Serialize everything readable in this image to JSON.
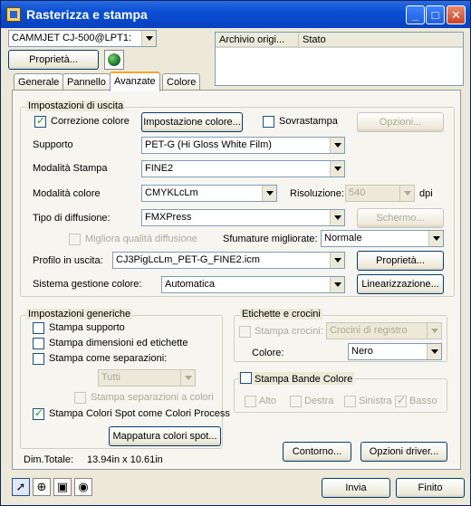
{
  "window": {
    "title": "Rasterizza e stampa"
  },
  "printer": {
    "selected": "CAMMJET CJ-500@LPT1:",
    "properties_label": "Proprietà..."
  },
  "jobs_list": {
    "columns": [
      "Archivio origi...",
      "Stato"
    ]
  },
  "tabs": [
    "Generale",
    "Pannello",
    "Avanzate",
    "Colore"
  ],
  "active_tab": "Avanzate",
  "output_settings": {
    "legend": "Impostazioni di uscita",
    "color_correction": {
      "label": "Correzione colore",
      "checked": true
    },
    "color_setup_button": "Impostazione colore...",
    "overprint": {
      "label": "Sovrastampa",
      "checked": false
    },
    "options_button": "Opzioni...",
    "media": {
      "label": "Supporto",
      "value": "PET-G (Hi Gloss White Film)"
    },
    "print_mode": {
      "label": "Modalità Stampa",
      "value": "FINE2"
    },
    "color_mode": {
      "label": "Modalità colore",
      "value": "CMYKLcLm"
    },
    "resolution": {
      "label": "Risoluzione:",
      "value": "540",
      "unit": "dpi"
    },
    "dither": {
      "label": "Tipo di diffusione:",
      "value": "FMXPress"
    },
    "screen_button": "Schermo...",
    "better_dither": {
      "label": "Migliora qualità diffusione",
      "checked": false
    },
    "gradients": {
      "label": "Sfumature migliorate:",
      "value": "Normale"
    },
    "output_profile": {
      "label": "Profilo in uscita:",
      "value": "CJ3PigLcLm_PET-G_FINE2.icm"
    },
    "profile_properties_button": "Proprietà...",
    "cms": {
      "label": "Sistema gestione colore:",
      "value": "Automatica"
    },
    "linearization_button": "Linearizzazione..."
  },
  "generic_settings": {
    "legend": "Impostazioni generiche",
    "print_media": {
      "label": "Stampa supporto",
      "checked": false
    },
    "print_size_labels": {
      "label": "Stampa dimensioni ed etichette",
      "checked": false
    },
    "print_separations": {
      "label": "Stampa come separazioni:",
      "checked": false
    },
    "separations_select": "Tutti",
    "print_color_separations": {
      "label": "Stampa separazioni a colori",
      "checked": false
    },
    "spot_as_process": {
      "label": "Stampa Colori Spot come Colori Process",
      "checked": true
    },
    "spot_mapping_button": "Mappatura colori spot..."
  },
  "labels_marks": {
    "legend": "Etichette e crocini",
    "print_marks": {
      "label": "Stampa crocini:",
      "checked": false
    },
    "marks_select": "Crocini di registro",
    "color": {
      "label": "Colore:",
      "value": "Nero"
    }
  },
  "color_bands": {
    "label": "Stampa Bande Colore",
    "checked": false,
    "positions": [
      {
        "label": "Alto",
        "checked": false
      },
      {
        "label": "Destra",
        "checked": false
      },
      {
        "label": "Sinistra",
        "checked": false
      },
      {
        "label": "Basso",
        "checked": true
      }
    ]
  },
  "dimensions": {
    "label": "Dim.Totale:",
    "value": "13.94in x 10.61in"
  },
  "contour_button": "Contorno...",
  "driver_options_button": "Opzioni driver...",
  "send_button": "Invia",
  "done_button": "Finito"
}
